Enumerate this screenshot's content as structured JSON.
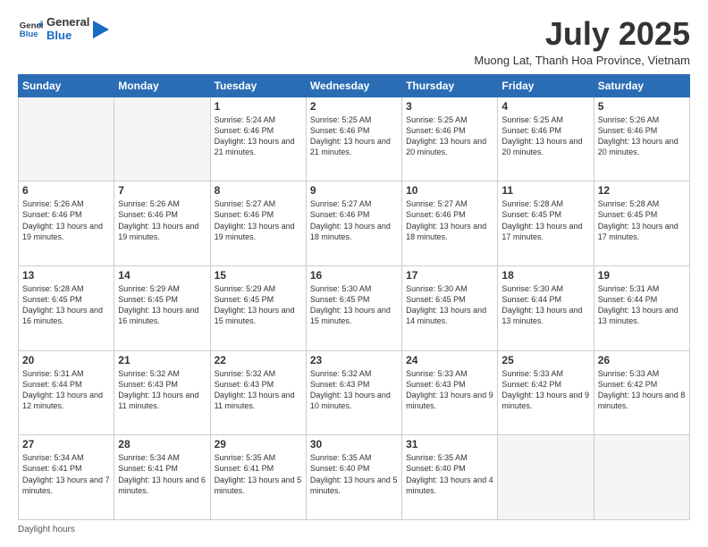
{
  "header": {
    "logo_general": "General",
    "logo_blue": "Blue",
    "month_title": "July 2025",
    "subtitle": "Muong Lat, Thanh Hoa Province, Vietnam"
  },
  "weekdays": [
    "Sunday",
    "Monday",
    "Tuesday",
    "Wednesday",
    "Thursday",
    "Friday",
    "Saturday"
  ],
  "weeks": [
    [
      {
        "day": "",
        "text": ""
      },
      {
        "day": "",
        "text": ""
      },
      {
        "day": "1",
        "text": "Sunrise: 5:24 AM\nSunset: 6:46 PM\nDaylight: 13 hours and 21 minutes."
      },
      {
        "day": "2",
        "text": "Sunrise: 5:25 AM\nSunset: 6:46 PM\nDaylight: 13 hours and 21 minutes."
      },
      {
        "day": "3",
        "text": "Sunrise: 5:25 AM\nSunset: 6:46 PM\nDaylight: 13 hours and 20 minutes."
      },
      {
        "day": "4",
        "text": "Sunrise: 5:25 AM\nSunset: 6:46 PM\nDaylight: 13 hours and 20 minutes."
      },
      {
        "day": "5",
        "text": "Sunrise: 5:26 AM\nSunset: 6:46 PM\nDaylight: 13 hours and 20 minutes."
      }
    ],
    [
      {
        "day": "6",
        "text": "Sunrise: 5:26 AM\nSunset: 6:46 PM\nDaylight: 13 hours and 19 minutes."
      },
      {
        "day": "7",
        "text": "Sunrise: 5:26 AM\nSunset: 6:46 PM\nDaylight: 13 hours and 19 minutes."
      },
      {
        "day": "8",
        "text": "Sunrise: 5:27 AM\nSunset: 6:46 PM\nDaylight: 13 hours and 19 minutes."
      },
      {
        "day": "9",
        "text": "Sunrise: 5:27 AM\nSunset: 6:46 PM\nDaylight: 13 hours and 18 minutes."
      },
      {
        "day": "10",
        "text": "Sunrise: 5:27 AM\nSunset: 6:46 PM\nDaylight: 13 hours and 18 minutes."
      },
      {
        "day": "11",
        "text": "Sunrise: 5:28 AM\nSunset: 6:45 PM\nDaylight: 13 hours and 17 minutes."
      },
      {
        "day": "12",
        "text": "Sunrise: 5:28 AM\nSunset: 6:45 PM\nDaylight: 13 hours and 17 minutes."
      }
    ],
    [
      {
        "day": "13",
        "text": "Sunrise: 5:28 AM\nSunset: 6:45 PM\nDaylight: 13 hours and 16 minutes."
      },
      {
        "day": "14",
        "text": "Sunrise: 5:29 AM\nSunset: 6:45 PM\nDaylight: 13 hours and 16 minutes."
      },
      {
        "day": "15",
        "text": "Sunrise: 5:29 AM\nSunset: 6:45 PM\nDaylight: 13 hours and 15 minutes."
      },
      {
        "day": "16",
        "text": "Sunrise: 5:30 AM\nSunset: 6:45 PM\nDaylight: 13 hours and 15 minutes."
      },
      {
        "day": "17",
        "text": "Sunrise: 5:30 AM\nSunset: 6:45 PM\nDaylight: 13 hours and 14 minutes."
      },
      {
        "day": "18",
        "text": "Sunrise: 5:30 AM\nSunset: 6:44 PM\nDaylight: 13 hours and 13 minutes."
      },
      {
        "day": "19",
        "text": "Sunrise: 5:31 AM\nSunset: 6:44 PM\nDaylight: 13 hours and 13 minutes."
      }
    ],
    [
      {
        "day": "20",
        "text": "Sunrise: 5:31 AM\nSunset: 6:44 PM\nDaylight: 13 hours and 12 minutes."
      },
      {
        "day": "21",
        "text": "Sunrise: 5:32 AM\nSunset: 6:43 PM\nDaylight: 13 hours and 11 minutes."
      },
      {
        "day": "22",
        "text": "Sunrise: 5:32 AM\nSunset: 6:43 PM\nDaylight: 13 hours and 11 minutes."
      },
      {
        "day": "23",
        "text": "Sunrise: 5:32 AM\nSunset: 6:43 PM\nDaylight: 13 hours and 10 minutes."
      },
      {
        "day": "24",
        "text": "Sunrise: 5:33 AM\nSunset: 6:43 PM\nDaylight: 13 hours and 9 minutes."
      },
      {
        "day": "25",
        "text": "Sunrise: 5:33 AM\nSunset: 6:42 PM\nDaylight: 13 hours and 9 minutes."
      },
      {
        "day": "26",
        "text": "Sunrise: 5:33 AM\nSunset: 6:42 PM\nDaylight: 13 hours and 8 minutes."
      }
    ],
    [
      {
        "day": "27",
        "text": "Sunrise: 5:34 AM\nSunset: 6:41 PM\nDaylight: 13 hours and 7 minutes."
      },
      {
        "day": "28",
        "text": "Sunrise: 5:34 AM\nSunset: 6:41 PM\nDaylight: 13 hours and 6 minutes."
      },
      {
        "day": "29",
        "text": "Sunrise: 5:35 AM\nSunset: 6:41 PM\nDaylight: 13 hours and 5 minutes."
      },
      {
        "day": "30",
        "text": "Sunrise: 5:35 AM\nSunset: 6:40 PM\nDaylight: 13 hours and 5 minutes."
      },
      {
        "day": "31",
        "text": "Sunrise: 5:35 AM\nSunset: 6:40 PM\nDaylight: 13 hours and 4 minutes."
      },
      {
        "day": "",
        "text": ""
      },
      {
        "day": "",
        "text": ""
      }
    ]
  ],
  "footer": {
    "daylight_label": "Daylight hours"
  }
}
